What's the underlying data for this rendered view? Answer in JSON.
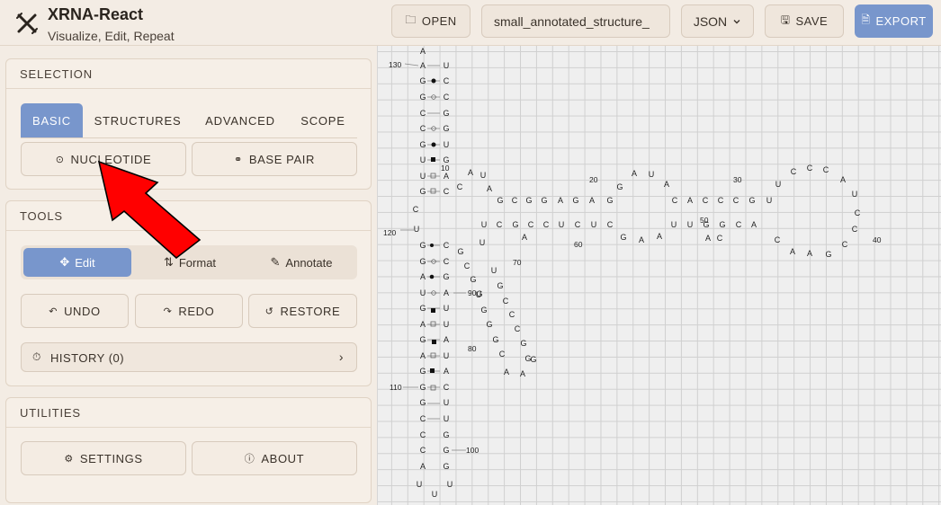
{
  "app": {
    "title": "XRNA-React",
    "subtitle": "Visualize, Edit, Repeat"
  },
  "header": {
    "open_label": "OPEN",
    "filename_value": "small_annotated_structure_",
    "format_value": "JSON",
    "save_label": "SAVE",
    "export_label": "EXPORT"
  },
  "selection": {
    "title": "SELECTION",
    "tabs": [
      "BASIC",
      "STRUCTURES",
      "ADVANCED",
      "SCOPE"
    ],
    "active_tab": "BASIC",
    "nucleotide_label": "NUCLEOTIDE",
    "base_pair_label": "BASE PAIR"
  },
  "tools": {
    "title": "TOOLS",
    "modes": [
      "Edit",
      "Format",
      "Annotate"
    ],
    "active_mode": "Edit",
    "undo_label": "UNDO",
    "redo_label": "REDO",
    "restore_label": "RESTORE",
    "history_label": "HISTORY (0)"
  },
  "utilities": {
    "title": "UTILITIES",
    "settings_label": "SETTINGS",
    "about_label": "ABOUT"
  },
  "colors": {
    "accent": "#7896cc",
    "arrow": "#ff0000",
    "panel_bg": "#f6efe7"
  },
  "canvas": {
    "index_labels": [
      "10",
      "20",
      "30",
      "40",
      "50",
      "60",
      "70",
      "80",
      "90",
      "100",
      "110",
      "120",
      "130"
    ]
  }
}
